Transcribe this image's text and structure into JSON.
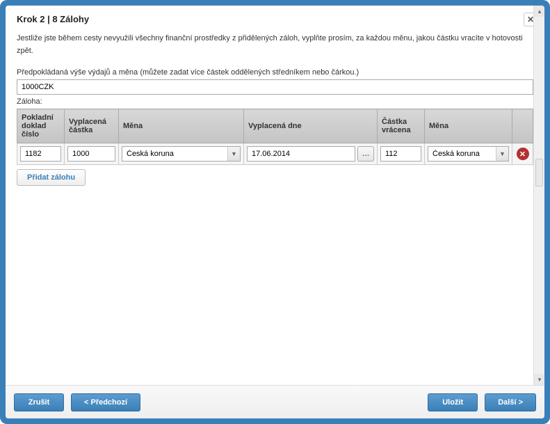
{
  "header": {
    "title": "Krok 2 | 8 Zálohy",
    "description": "Jestliže jste během cesty nevyužili všechny finanční prostředky z přidělených záloh, vyplňte prosím, za každou měnu, jakou částku vracíte v hotovosti zpět."
  },
  "expenses": {
    "label": "Předpokládaná výše výdajů a měna (můžete zadat více částek oddělených středníkem nebo čárkou.)",
    "value": "1000CZK"
  },
  "zaloha_label": "Záloha:",
  "columns": {
    "c0": "Pokladní doklad číslo",
    "c1": "Vyplacená částka",
    "c2": "Měna",
    "c3": "Vyplacená dne",
    "c4": "Částka vrácena",
    "c5": "Měna"
  },
  "row": {
    "doc": "1182",
    "paid": "1000",
    "cur1": "Česká koruna",
    "date": "17.06.2014",
    "returned": "112",
    "cur2": "Česká koruna"
  },
  "buttons": {
    "add": "Přidat zálohu",
    "cancel": "Zrušit",
    "prev": "< Předchozí",
    "save": "Uložit",
    "next": "Další >",
    "date_picker": "…"
  }
}
